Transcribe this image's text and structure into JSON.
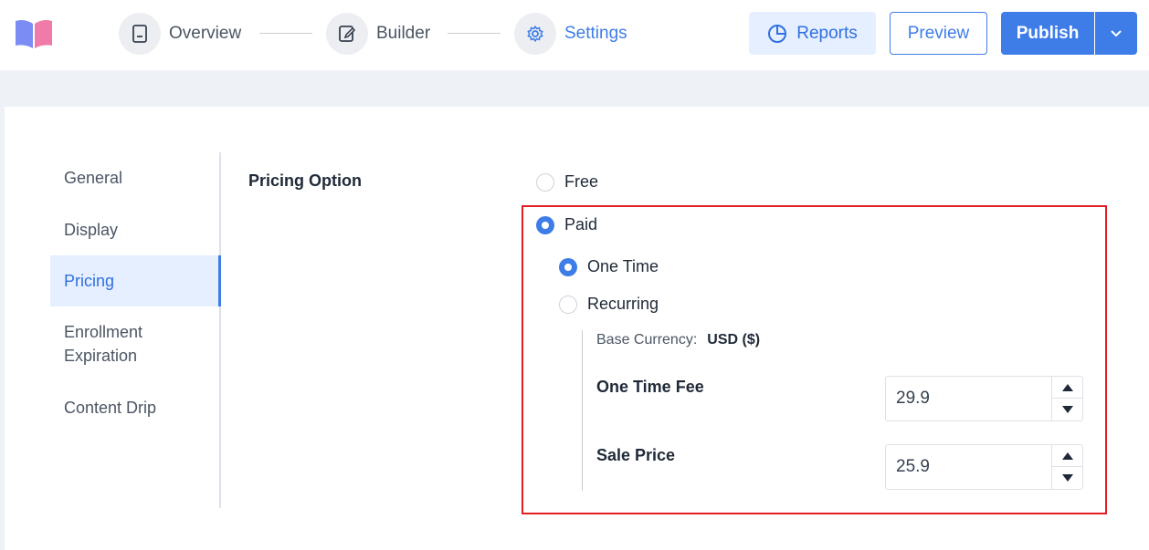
{
  "app": {
    "logo_icon": "book-logo-icon",
    "brand_colors": {
      "primary": "#3e7de8",
      "logo_left": "#7b8cf5",
      "logo_right": "#f07aa8"
    }
  },
  "steps": [
    {
      "label": "Overview",
      "icon": "document-icon"
    },
    {
      "label": "Builder",
      "icon": "edit-icon"
    },
    {
      "label": "Settings",
      "icon": "gear-icon"
    }
  ],
  "toolbar": {
    "reports_label": "Reports",
    "reports_icon": "pie-chart-icon",
    "preview_label": "Preview",
    "publish_label": "Publish",
    "publish_menu_icon": "chevron-down-icon"
  },
  "sidebar": {
    "items": [
      {
        "label": "General"
      },
      {
        "label": "Display"
      },
      {
        "label": "Pricing"
      },
      {
        "label": "Enrollment Expiration"
      },
      {
        "label": "Content Drip"
      }
    ]
  },
  "pricing": {
    "section_label": "Pricing Option",
    "options": [
      {
        "label": "Free",
        "selected": false
      },
      {
        "label": "Paid",
        "selected": true
      }
    ],
    "payment_types": [
      {
        "label": "One Time",
        "selected": true
      },
      {
        "label": "Recurring",
        "selected": false
      }
    ],
    "currency_label": "Base Currency:",
    "currency_value": "USD ($)",
    "one_time_fee_label": "One Time Fee",
    "one_time_fee_value": "29.9",
    "sale_price_label": "Sale Price",
    "sale_price_value": "25.9"
  },
  "highlight_color": "#e11d26"
}
